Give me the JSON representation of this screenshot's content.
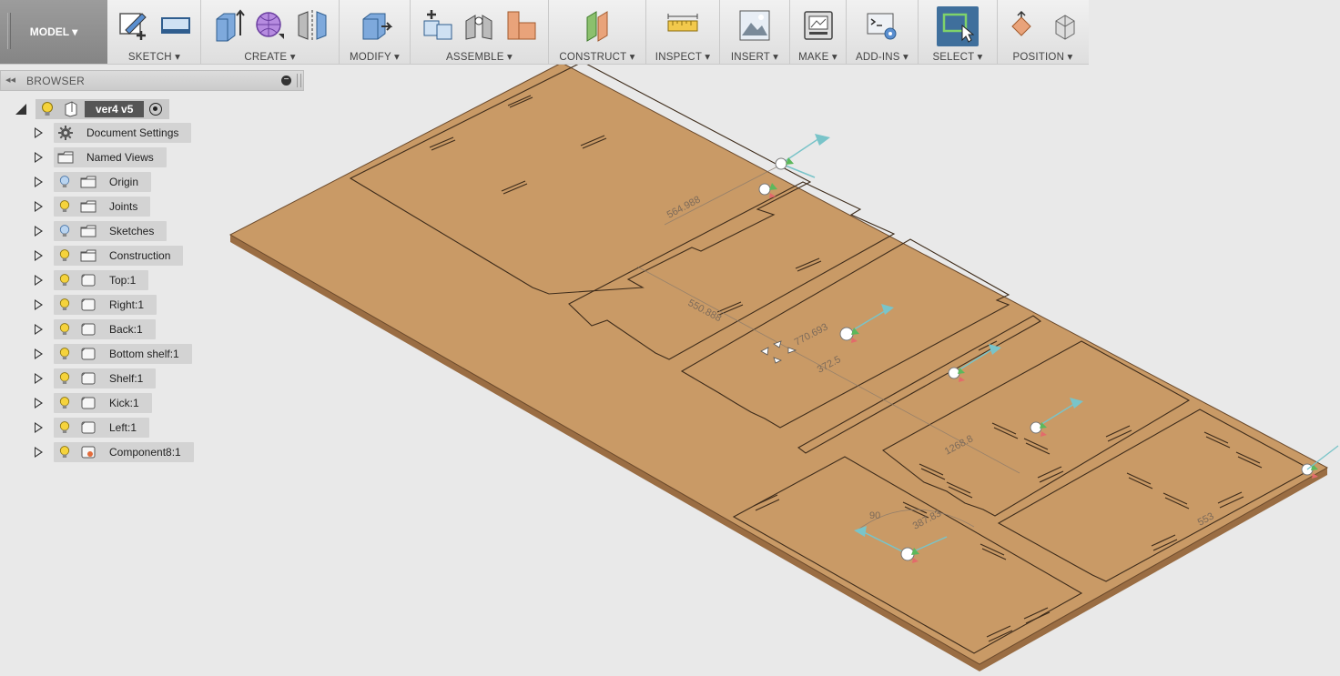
{
  "workspace": {
    "label": "MODEL ▾"
  },
  "toolbar": {
    "groups": [
      {
        "id": "sketch",
        "label": "SKETCH ▾"
      },
      {
        "id": "create",
        "label": "CREATE ▾"
      },
      {
        "id": "modify",
        "label": "MODIFY ▾"
      },
      {
        "id": "assemble",
        "label": "ASSEMBLE ▾"
      },
      {
        "id": "construct",
        "label": "CONSTRUCT ▾"
      },
      {
        "id": "inspect",
        "label": "INSPECT ▾"
      },
      {
        "id": "insert",
        "label": "INSERT ▾"
      },
      {
        "id": "make",
        "label": "MAKE ▾"
      },
      {
        "id": "addins",
        "label": "ADD-INS ▾"
      },
      {
        "id": "select",
        "label": "SELECT ▾"
      },
      {
        "id": "position",
        "label": "POSITION ▾"
      }
    ]
  },
  "browser": {
    "title": "BROWSER",
    "root": {
      "name": "ver4 v5"
    },
    "items": [
      {
        "label": "Document Settings",
        "icon": "gear-icon"
      },
      {
        "label": "Named Views",
        "icon": "folder-icon"
      },
      {
        "label": "Origin",
        "icon": "folder-icon",
        "bulb": "bulb-off-icon"
      },
      {
        "label": "Joints",
        "icon": "folder-icon",
        "bulb": "bulb-on-icon"
      },
      {
        "label": "Sketches",
        "icon": "folder-icon",
        "bulb": "bulb-off-icon"
      },
      {
        "label": "Construction",
        "icon": "folder-icon",
        "bulb": "bulb-on-icon"
      },
      {
        "label": "Top:1",
        "icon": "component-icon",
        "bulb": "bulb-on-icon"
      },
      {
        "label": "Right:1",
        "icon": "component-icon",
        "bulb": "bulb-on-icon"
      },
      {
        "label": "Back:1",
        "icon": "component-icon",
        "bulb": "bulb-on-icon"
      },
      {
        "label": "Bottom shelf:1",
        "icon": "component-icon",
        "bulb": "bulb-on-icon"
      },
      {
        "label": "Shelf:1",
        "icon": "component-icon",
        "bulb": "bulb-on-icon"
      },
      {
        "label": "Kick:1",
        "icon": "component-icon",
        "bulb": "bulb-on-icon"
      },
      {
        "label": "Left:1",
        "icon": "component-icon",
        "bulb": "bulb-on-icon"
      },
      {
        "label": "Component8:1",
        "icon": "component-linked-icon",
        "bulb": "bulb-on-icon"
      }
    ]
  },
  "viewport": {
    "dimensions": [
      "564.988",
      "550.888",
      "770.693",
      "372.5",
      "1268.8",
      "553",
      "90",
      "387.83"
    ],
    "colors": {
      "board": "#c99a66",
      "board_edge": "#9a6d43",
      "cut_line": "#4a3421",
      "axis": "#79c4c9"
    }
  }
}
